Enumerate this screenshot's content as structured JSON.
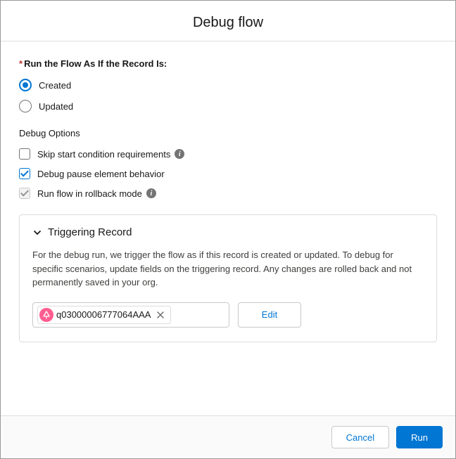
{
  "header": {
    "title": "Debug flow"
  },
  "run_as": {
    "label": "Run the Flow As If the Record Is:",
    "options": {
      "created": "Created",
      "updated": "Updated"
    },
    "selected": "created"
  },
  "debug_options": {
    "title": "Debug Options",
    "skip_start": {
      "label": "Skip start condition requirements",
      "checked": false,
      "has_info": true
    },
    "pause_behavior": {
      "label": "Debug pause element behavior",
      "checked": true,
      "has_info": false
    },
    "rollback": {
      "label": "Run flow in rollback mode",
      "checked": true,
      "disabled": true,
      "has_info": true
    }
  },
  "triggering_record": {
    "title": "Triggering Record",
    "description": "For the debug run, we trigger the flow as if this record is created or updated. To debug for specific scenarios, update fields on the triggering record. Any changes are rolled back and not permanently saved in your org.",
    "record_id": "q03000006777064AAA",
    "edit_label": "Edit"
  },
  "footer": {
    "cancel": "Cancel",
    "run": "Run"
  }
}
